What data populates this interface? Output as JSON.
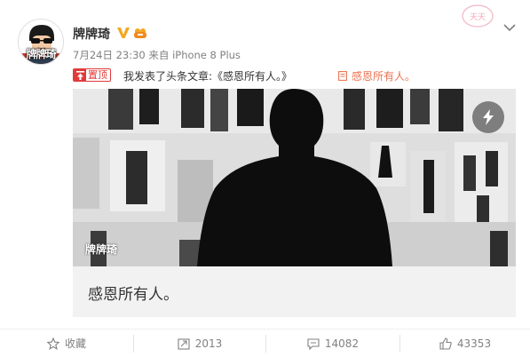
{
  "post": {
    "username": "牌牌琦",
    "avatar_text": "牌牌琦",
    "timestamp": "7月24日 23:30",
    "source_prefix": "来自",
    "source_device": "iPhone 8 Plus",
    "pin_label": "置顶",
    "text": "我发表了头条文章:《感恩所有人。》",
    "article_link_text": "感恩所有人。",
    "stamp_text": "天天"
  },
  "article": {
    "watermark": "牌牌琦",
    "title": "感恩所有人。"
  },
  "actions": {
    "favorite_label": "收藏",
    "repost_count": "2013",
    "comment_count": "14082",
    "like_count": "43353"
  },
  "colors": {
    "link_orange": "#eb7350",
    "pin_red": "#e03a3a",
    "verified_gold": "#f5a623",
    "text_gray": "#808080"
  }
}
